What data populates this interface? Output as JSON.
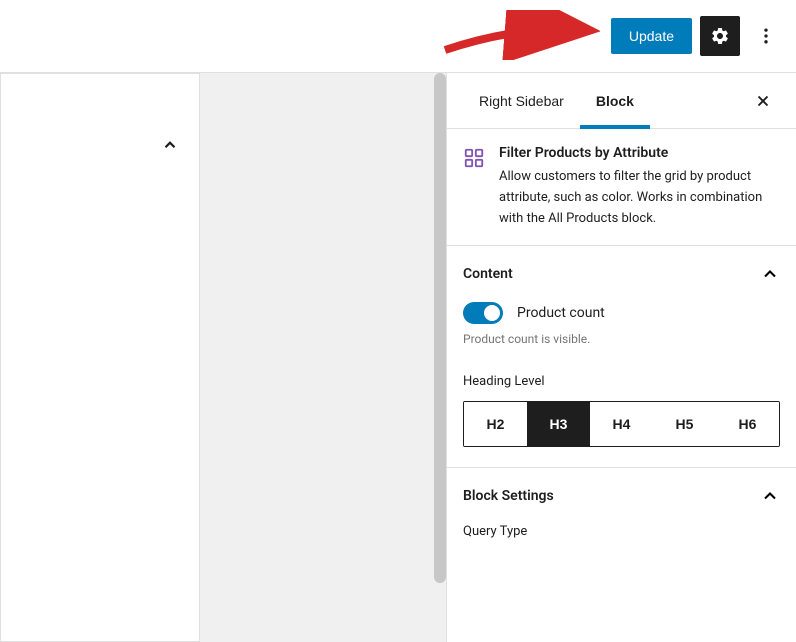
{
  "topbar": {
    "update_label": "Update"
  },
  "sidebar": {
    "tabs": {
      "right_sidebar": "Right Sidebar",
      "block": "Block"
    },
    "block_info": {
      "title": "Filter Products by Attribute",
      "description": "Allow customers to filter the grid by product attribute, such as color. Works in combination with the All Products block."
    },
    "panels": {
      "content": {
        "title": "Content",
        "toggle_label": "Product count",
        "toggle_hint": "Product count is visible.",
        "heading_label": "Heading Level",
        "headings": [
          "H2",
          "H3",
          "H4",
          "H5",
          "H6"
        ],
        "selected": "H3"
      },
      "block_settings": {
        "title": "Block Settings",
        "partial": "Query Type"
      }
    }
  }
}
